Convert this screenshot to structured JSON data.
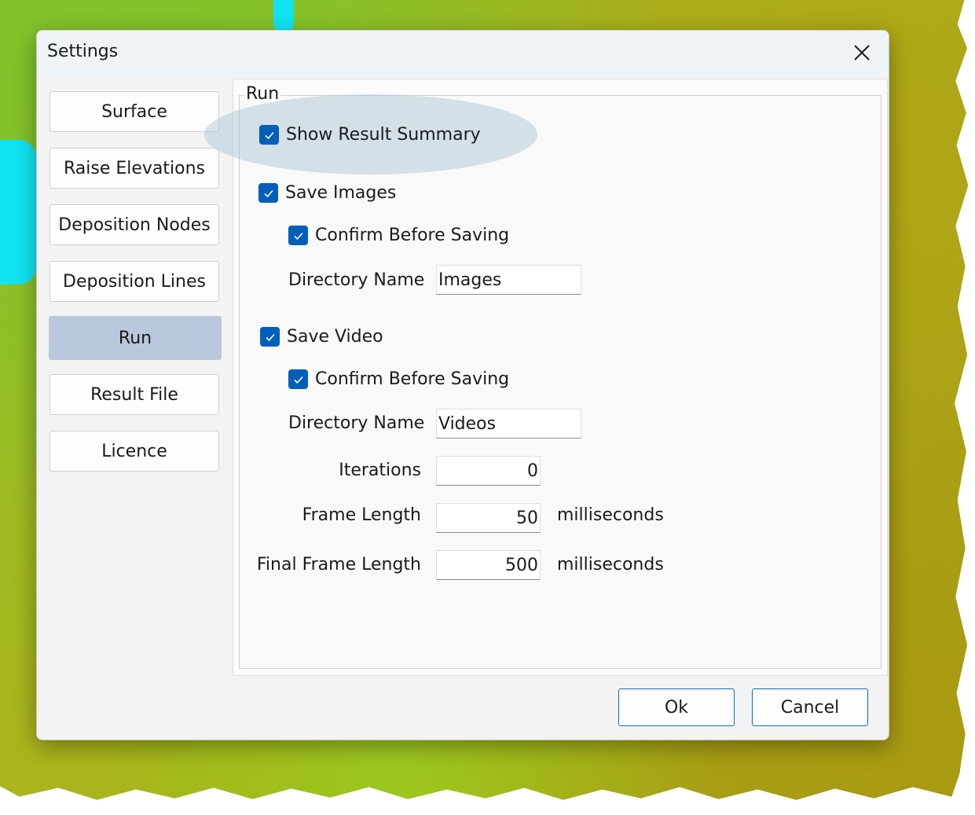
{
  "window": {
    "title": "Settings",
    "close_icon": "close-icon"
  },
  "sidebar": {
    "items": [
      {
        "label": "Surface",
        "active": false
      },
      {
        "label": "Raise Elevations",
        "active": false
      },
      {
        "label": "Deposition Nodes",
        "active": false
      },
      {
        "label": "Deposition Lines",
        "active": false
      },
      {
        "label": "Run",
        "active": true
      },
      {
        "label": "Result File",
        "active": false
      },
      {
        "label": "Licence",
        "active": false
      }
    ]
  },
  "run": {
    "group_title": "Run",
    "show_result_summary": {
      "label": "Show Result Summary",
      "checked": true
    },
    "save_images": {
      "label": "Save Images",
      "checked": true,
      "confirm": {
        "label": "Confirm Before Saving",
        "checked": true
      },
      "directory_label": "Directory Name",
      "directory_value": "Images"
    },
    "save_video": {
      "label": "Save Video",
      "checked": true,
      "confirm": {
        "label": "Confirm Before Saving",
        "checked": true
      },
      "directory_label": "Directory Name",
      "directory_value": "Videos"
    },
    "iterations": {
      "label": "Iterations",
      "value": "0"
    },
    "frame_length": {
      "label": "Frame Length",
      "value": "50",
      "unit": "milliseconds"
    },
    "final_frame_length": {
      "label": "Final Frame Length",
      "value": "500",
      "unit": "milliseconds"
    }
  },
  "buttons": {
    "ok": "Ok",
    "cancel": "Cancel"
  },
  "colors": {
    "accent": "#005fb8",
    "active_nav": "#b9c8dc",
    "highlight": "#a0bed2"
  }
}
